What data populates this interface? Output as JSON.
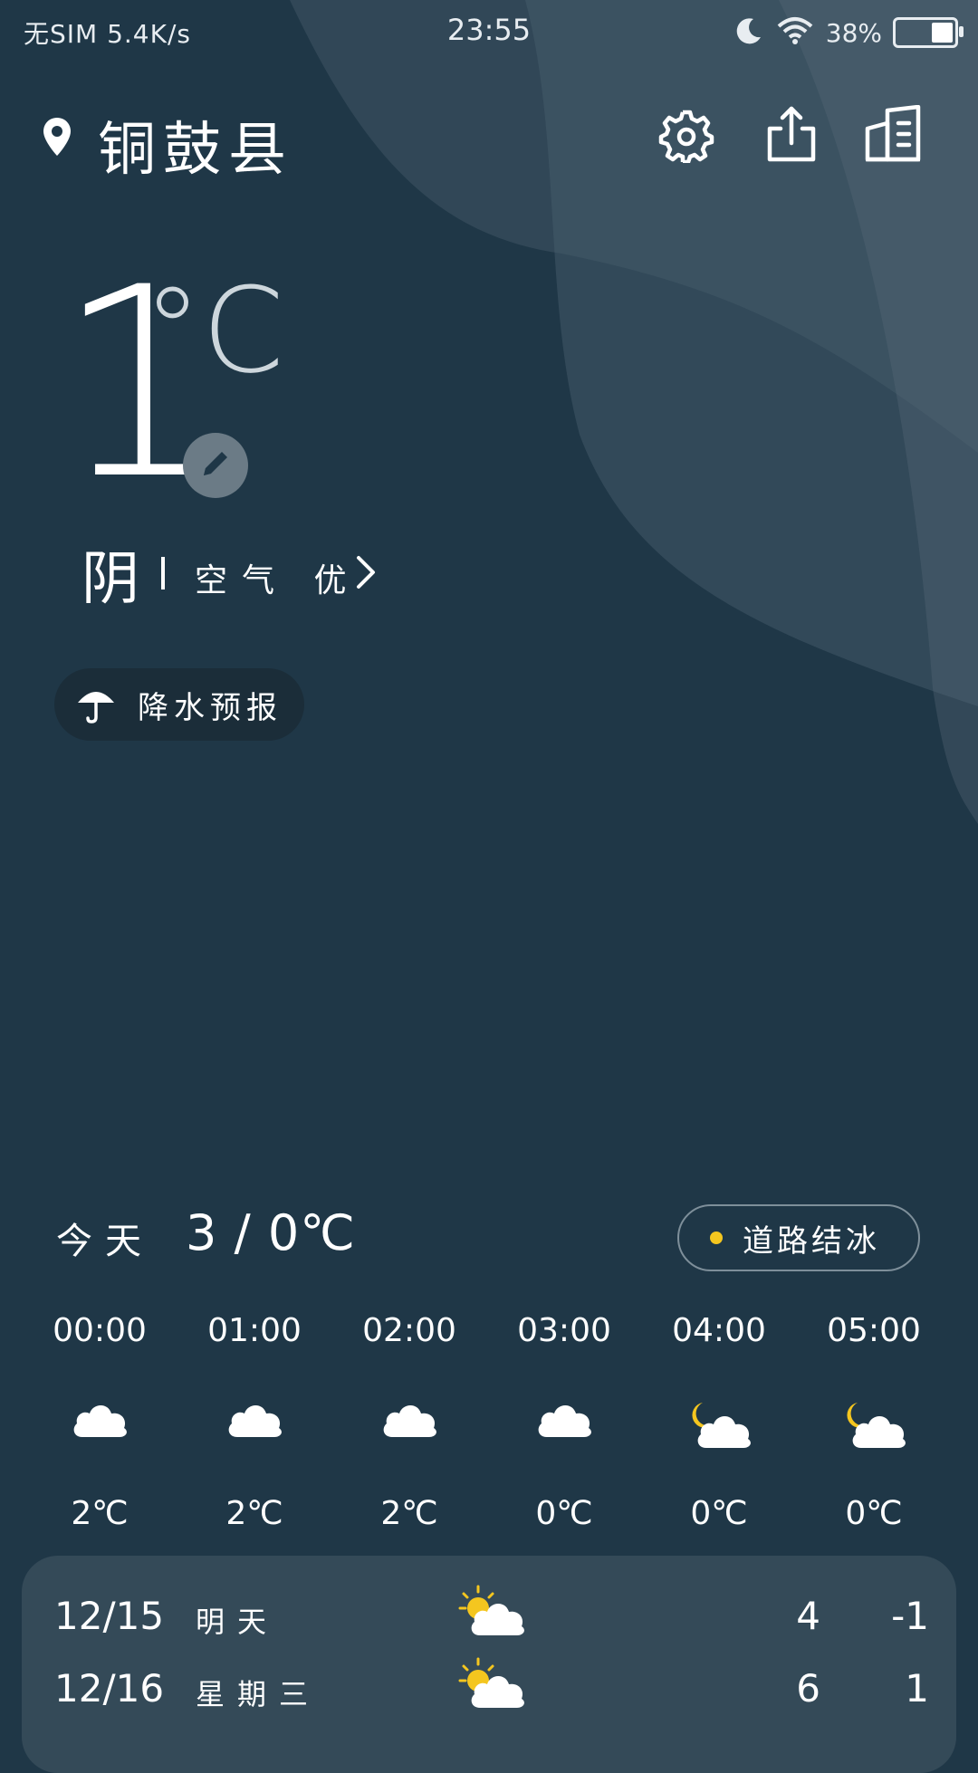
{
  "status_bar": {
    "left_text": "无SIM 5.4K/s",
    "time": "23:55",
    "battery_percent": "38%",
    "battery_level": 0.38
  },
  "header": {
    "city": "铜鼓县",
    "icons": [
      "location-pin-icon",
      "gear-icon",
      "share-icon",
      "city-manage-icon"
    ]
  },
  "current": {
    "temp": "1",
    "unit": "°C",
    "condition": "阴",
    "air_quality": "空气 优"
  },
  "precip_button": {
    "label": "降水预报",
    "icon": "umbrella-icon"
  },
  "today": {
    "label": "今天",
    "range": "3 / 0℃",
    "badge": "道路结冰",
    "badge_dot_color": "#f4c61f"
  },
  "hourly": [
    {
      "time": "00:00",
      "icon": "cloud-icon",
      "temp": "2℃"
    },
    {
      "time": "01:00",
      "icon": "cloud-icon",
      "temp": "2℃"
    },
    {
      "time": "02:00",
      "icon": "cloud-icon",
      "temp": "2℃"
    },
    {
      "time": "03:00",
      "icon": "cloud-icon",
      "temp": "0℃"
    },
    {
      "time": "04:00",
      "icon": "partly-cloudy-night-icon",
      "temp": "0℃"
    },
    {
      "time": "05:00",
      "icon": "partly-cloudy-night-icon",
      "temp": "0℃"
    }
  ],
  "daily": [
    {
      "date": "12/15",
      "name": "明天",
      "icon": "partly-cloudy-day-icon",
      "high": "4",
      "low": "-1"
    },
    {
      "date": "12/16",
      "name": "星期三",
      "icon": "partly-cloudy-day-icon",
      "high": "6",
      "low": "1"
    }
  ],
  "colors": {
    "background": "#1f3747",
    "card": "#344a58",
    "sun": "#f4c61f"
  }
}
